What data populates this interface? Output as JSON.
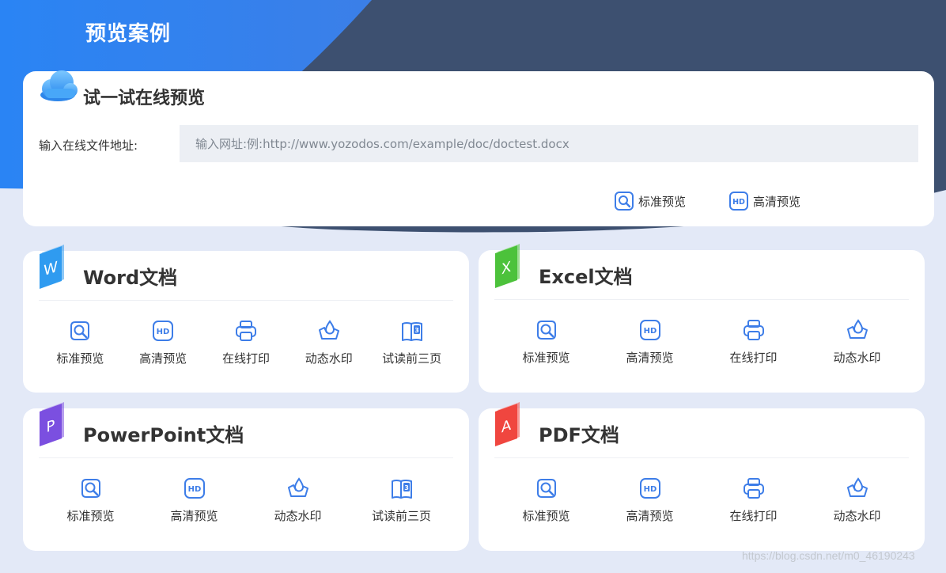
{
  "page": {
    "title": "预览案例"
  },
  "try_panel": {
    "title": "试一试在线预览",
    "url_label": "输入在线文件地址:",
    "url_placeholder": "输入网址:例:http://www.yozodos.com/example/doc/doctest.docx",
    "url_value": "",
    "buttons": [
      {
        "label": "标准预览",
        "icon": "magnifier-icon"
      },
      {
        "label": "高清预览",
        "icon": "hd-icon"
      }
    ]
  },
  "doc_cards": [
    {
      "title": "Word文档",
      "icon": "word-icon",
      "icon_letter": "W",
      "icon_color": "#2f9bf0",
      "actions": [
        {
          "label": "标准预览",
          "icon": "magnifier-icon"
        },
        {
          "label": "高清预览",
          "icon": "hd-icon"
        },
        {
          "label": "在线打印",
          "icon": "printer-icon"
        },
        {
          "label": "动态水印",
          "icon": "watermark-icon"
        },
        {
          "label": "试读前三页",
          "icon": "book-icon"
        }
      ]
    },
    {
      "title": "Excel文档",
      "icon": "excel-icon",
      "icon_letter": "X",
      "icon_color": "#4cc23b",
      "actions": [
        {
          "label": "标准预览",
          "icon": "magnifier-icon"
        },
        {
          "label": "高清预览",
          "icon": "hd-icon"
        },
        {
          "label": "在线打印",
          "icon": "printer-icon"
        },
        {
          "label": "动态水印",
          "icon": "watermark-icon"
        }
      ]
    },
    {
      "title": "PowerPoint文档",
      "icon": "powerpoint-icon",
      "icon_letter": "P",
      "icon_color": "#7b4fe0",
      "actions": [
        {
          "label": "标准预览",
          "icon": "magnifier-icon"
        },
        {
          "label": "高清预览",
          "icon": "hd-icon"
        },
        {
          "label": "动态水印",
          "icon": "watermark-icon"
        },
        {
          "label": "试读前三页",
          "icon": "book-icon"
        }
      ]
    },
    {
      "title": "PDF文档",
      "icon": "pdf-icon",
      "icon_letter": "A",
      "icon_color": "#f0463f",
      "actions": [
        {
          "label": "标准预览",
          "icon": "magnifier-icon"
        },
        {
          "label": "高清预览",
          "icon": "hd-icon"
        },
        {
          "label": "在线打印",
          "icon": "printer-icon"
        },
        {
          "label": "动态水印",
          "icon": "watermark-icon"
        }
      ]
    }
  ],
  "colors": {
    "accent": "#3d7de8",
    "header_dark": "#3d5070",
    "header_blue": "#2f7ff0",
    "page_bg": "#e3e9f7"
  },
  "watermark": "https://blog.csdn.net/m0_46190243"
}
